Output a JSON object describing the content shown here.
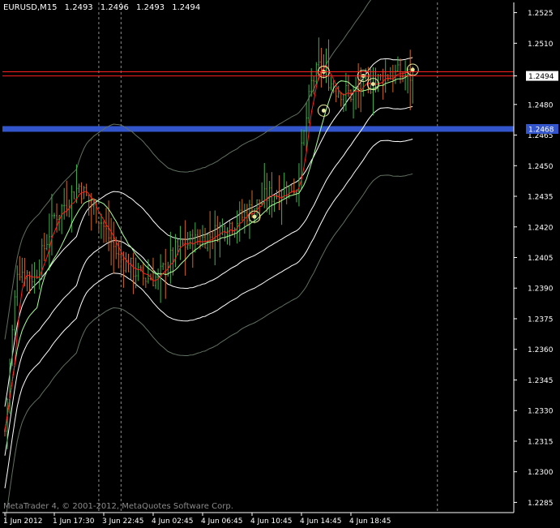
{
  "header": {
    "symbol_timeframe": "EURUSD,M15",
    "open": "1.2493",
    "high": "1.2496",
    "low": "1.2493",
    "close": "1.2494"
  },
  "footer": {
    "copyright": "MetaTrader 4, © 2001-2012, MetaQuotes Software Corp."
  },
  "colors": {
    "background": "#000000",
    "axis": "#ffffff",
    "grid_vertical": "#c8c8c8",
    "bull_bar": "#3cb44b",
    "bear_bar": "#d2691e",
    "fast_ma": "#ff2020",
    "slow_ma": "#a8ff9a",
    "envelope_inner": "#ffffff",
    "envelope_outer": "#607060",
    "price_line": "#ff2020",
    "support_level": "#3355cc",
    "signal_marker": "#e8e8a0"
  },
  "chart_data": {
    "type": "ohlc",
    "ylim": [
      1.228,
      1.253
    ],
    "y_ticks": [
      "1.2525",
      "1.2510",
      "1.2494",
      "1.2480",
      "1.2465",
      "1.2450",
      "1.2435",
      "1.2420",
      "1.2405",
      "1.2390",
      "1.2375",
      "1.2360",
      "1.2345",
      "1.2330",
      "1.2315",
      "1.2300",
      "1.2285"
    ],
    "x_ticks": [
      "1 Jun 2012",
      "1 Jun 17:30",
      "3 Jun 22:45",
      "4 Jun 02:45",
      "4 Jun 06:45",
      "4 Jun 10:45",
      "4 Jun 14:45",
      "4 Jun 18:45"
    ],
    "x_tick_positions": [
      0,
      20,
      40,
      60,
      80,
      100,
      120,
      140
    ],
    "bar_count": 166,
    "close_anchors": [
      [
        0,
        1.232
      ],
      [
        5,
        1.24
      ],
      [
        12,
        1.2395
      ],
      [
        20,
        1.2425
      ],
      [
        30,
        1.244
      ],
      [
        38,
        1.2425
      ],
      [
        46,
        1.2405
      ],
      [
        56,
        1.2395
      ],
      [
        62,
        1.2395
      ],
      [
        70,
        1.241
      ],
      [
        82,
        1.2415
      ],
      [
        96,
        1.2425
      ],
      [
        106,
        1.2435
      ],
      [
        118,
        1.244
      ],
      [
        124,
        1.249
      ],
      [
        128,
        1.25
      ],
      [
        133,
        1.2488
      ],
      [
        140,
        1.2485
      ],
      [
        148,
        1.249
      ],
      [
        156,
        1.2495
      ],
      [
        165,
        1.2494
      ]
    ],
    "current_price": 1.2494,
    "price_line_2": 1.2496,
    "support_level": 1.2468,
    "support_label": "1.2468",
    "vertical_separators": [
      38,
      47,
      175
    ],
    "signals": [
      [
        129,
        1.2496
      ],
      [
        129,
        1.2477
      ],
      [
        145,
        1.2494
      ],
      [
        149,
        1.249
      ],
      [
        165,
        1.2497
      ],
      [
        101,
        1.2425
      ]
    ]
  }
}
